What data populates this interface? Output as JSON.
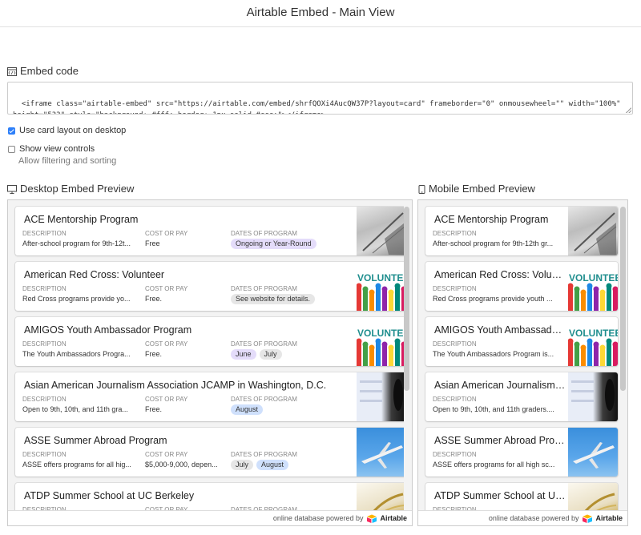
{
  "window": {
    "title": "Airtable Embed - Main View"
  },
  "embed": {
    "label": "Embed code",
    "code": "<iframe class=\"airtable-embed\" src=\"https://airtable.com/embed/shrfQOXi4AucQW37P?layout=card\" frameborder=\"0\" onmousewheel=\"\" width=\"100%\" height=\"533\" style=\"background: #fff; border: 1px solid #ccc;\"></iframe>"
  },
  "options": {
    "card_layout": {
      "label": "Use card layout on desktop",
      "checked": true
    },
    "view_controls": {
      "label": "Show view controls",
      "sublabel": "Allow filtering and sorting",
      "checked": false
    }
  },
  "desktop_preview": {
    "label": "Desktop Embed Preview"
  },
  "mobile_preview": {
    "label": "Mobile Embed Preview"
  },
  "field_labels": {
    "description": "DESCRIPTION",
    "cost": "COST OR PAY",
    "dates": "DATES OF PROGRAM"
  },
  "colors": {
    "accent": "#2d7ff9",
    "pill_purple": "#e4dcfa",
    "pill_gray": "#e6e6e6",
    "pill_blue": "#cfe0fc"
  },
  "desktop_cards": [
    {
      "title": "ACE Mentorship Program",
      "description": "After-school program for 9th-12t...",
      "cost": "Free",
      "dates": [
        {
          "text": "Ongoing or Year-Round",
          "color": "#e4dcfa"
        }
      ],
      "thumb": "sketch"
    },
    {
      "title": "American Red Cross: Volunteer",
      "description": "Red Cross programs provide yo...",
      "cost": "Free.",
      "dates": [
        {
          "text": "See website for details.",
          "color": "#e6e6e6"
        }
      ],
      "thumb": "volunteer"
    },
    {
      "title": "AMIGOS Youth Ambassador Program",
      "description": "The Youth Ambassadors Progra...",
      "cost": "Free.",
      "dates": [
        {
          "text": "June",
          "color": "#e4dcfa"
        },
        {
          "text": "July",
          "color": "#e6e6e6"
        }
      ],
      "thumb": "volunteer"
    },
    {
      "title": "Asian American Journalism Association JCAMP in Washington, D.C.",
      "description": "Open to 9th, 10th, and 11th gra...",
      "cost": "Free.",
      "dates": [
        {
          "text": "August",
          "color": "#cfe0fc"
        }
      ],
      "thumb": "mic"
    },
    {
      "title": "ASSE Summer Abroad Program",
      "description": "ASSE offers programs for all hig...",
      "cost": "$5,000-9,000, depen...",
      "dates": [
        {
          "text": "July",
          "color": "#e6e6e6"
        },
        {
          "text": "August",
          "color": "#cfe0fc"
        }
      ],
      "thumb": "plane"
    },
    {
      "title": "ATDP Summer School at UC Berkeley",
      "description": "",
      "cost": "",
      "dates": [],
      "thumb": "gold"
    }
  ],
  "mobile_cards": [
    {
      "title": "ACE Mentorship Program",
      "description": "After-school program for 9th-12th gr...",
      "thumb": "sketch"
    },
    {
      "title": "American Red Cross: Volunteer",
      "description": "Red Cross programs provide youth ...",
      "thumb": "volunteer"
    },
    {
      "title": "AMIGOS Youth Ambassador Program",
      "description": "The Youth Ambassadors Program is...",
      "thumb": "volunteer"
    },
    {
      "title": "Asian American Journalism Association JCAMP in Washington, D.C.",
      "description": "Open to 9th, 10th, and 11th graders....",
      "thumb": "mic"
    },
    {
      "title": "ASSE Summer Abroad Program",
      "description": "ASSE offers programs for all high sc...",
      "thumb": "plane"
    },
    {
      "title": "ATDP Summer School at UC Berkeley",
      "description": "",
      "thumb": "gold"
    }
  ],
  "footer": {
    "powered_text": "online database powered by",
    "brand": "Airtable"
  }
}
